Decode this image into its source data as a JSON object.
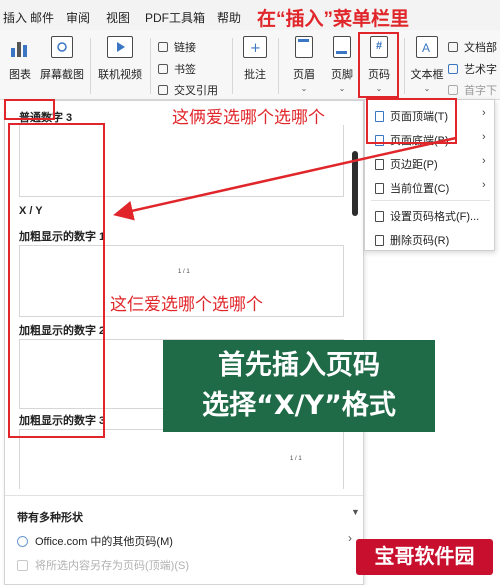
{
  "menu": {
    "items": [
      "插入",
      "邮件",
      "审阅",
      "视图",
      "PDF工具箱",
      "帮助"
    ],
    "hint": "在“插入”菜单栏里"
  },
  "ribbon": {
    "chart": "图表",
    "screenshot": "屏幕截图",
    "online_video": "联机视频",
    "link": "链接",
    "bookmark": "书签",
    "cross_ref": "交叉引用",
    "comment": "批注",
    "header": "页眉",
    "footer": "页脚",
    "page_number": "页码",
    "textbox": "文本框",
    "doc_parts": "文档部",
    "wordart": "艺术字",
    "dropcap": "首字下",
    "page_number_icon": "#"
  },
  "gallery": {
    "section_plain": "普通数字 3",
    "section_xy": "X / Y",
    "bold1": "加粗显示的数字 1",
    "bold2": "加粗显示的数字 2",
    "bold3": "加粗显示的数字 3",
    "preview_num": "1 / 1",
    "section_more": "带有多种形状",
    "office_more": "Office.com 中的其他页码(M)",
    "save_selection": "将所选内容另存为页码(顶端)(S)"
  },
  "dropdown": {
    "items": [
      "页面顶端(T)",
      "页面底端(B)",
      "页边距(P)",
      "当前位置(C)",
      "设置页码格式(F)...",
      "删除页码(R)"
    ]
  },
  "annotations": {
    "top_right": "这俩爱选哪个选哪个",
    "middle": "这仨爱选哪个选哪个",
    "green_line1": "首先插入页码",
    "green_line2": "选择“X/Y”格式"
  },
  "watermark": "宝哥软件园",
  "colors": {
    "annotation_red": "#e0262a",
    "box_green": "#1f6b48",
    "watermark_red": "#c8102e"
  }
}
